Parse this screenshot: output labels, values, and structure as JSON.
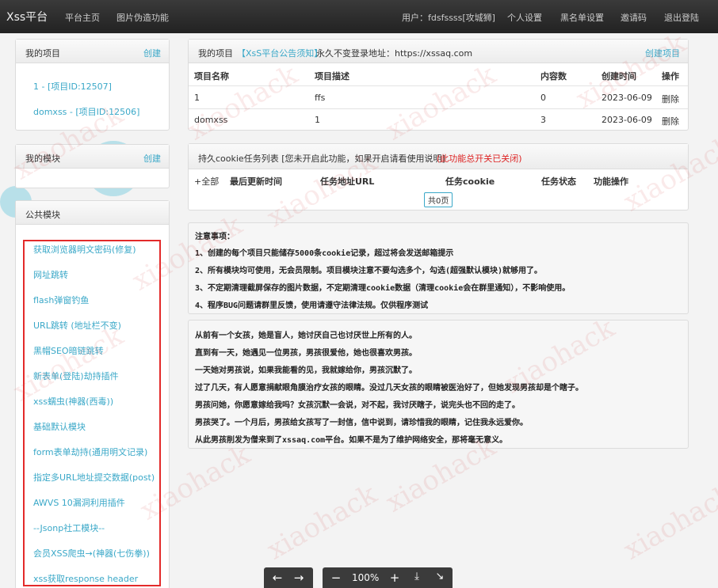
{
  "topbar": {
    "brand": "Xss平台",
    "nav_left": [
      "平台主页",
      "图片伪造功能"
    ],
    "user": "用户：fdsfssss[攻城狮]",
    "nav_right": [
      "个人设置",
      "黑名单设置",
      "邀请码",
      "退出登陆"
    ]
  },
  "sidebar": {
    "projects": {
      "title": "我的项目",
      "create": "创建",
      "items": [
        "1 - [项目ID:12507]",
        "domxss - [项目ID:12506]"
      ]
    },
    "modules": {
      "title": "我的模块",
      "create": "创建"
    },
    "public": {
      "title": "公共模块",
      "items": [
        "获取浏览器明文密码(修复)",
        "网址跳转",
        "flash弹窗钓鱼",
        "URL跳转 (地址栏不变)",
        "黑帽SEO暗链跳转",
        "新表单(登陆)劫持插件",
        "xss蠕虫(神器(西毒))",
        "基础默认模块",
        "form表单劫持(通用明文记录)",
        "指定多URL地址提交数据(post)",
        "AWVS 10漏洞利用插件",
        "--Jsonp社工模块--",
        "会员XSS爬虫→(神器(七伤拳))",
        "xss获取response header"
      ]
    }
  },
  "projects_panel": {
    "title": "我的项目",
    "notice": "【XsS平台公告须知】",
    "login_url_label": "永久不变登录地址：https://xssaq.com",
    "create": "创建项目",
    "headers": [
      "项目名称",
      "项目描述",
      "内容数",
      "创建时间",
      "操作"
    ],
    "rows": [
      {
        "name": "1",
        "desc": "ffs",
        "count": "0",
        "date": "2023-06-09",
        "action": "删除"
      },
      {
        "name": "domxss",
        "desc": "1",
        "count": "3",
        "date": "2023-06-09",
        "action": "删除"
      }
    ]
  },
  "cookie_panel": {
    "title": "持久cookie任务列表 [您未开启此功能，如果开启请看使用说明]",
    "warning": "(此功能总开关已关闭)",
    "add": "+全部",
    "headers": [
      "最后更新时间",
      "任务地址URL",
      "任务cookie",
      "任务状态",
      "功能操作"
    ],
    "pager": "共0页"
  },
  "notes": {
    "title": "注意事项：",
    "lines": [
      "1、创建的每个项目只能储存5000条cookie记录，超过将会发送邮箱提示",
      "2、所有模块均可使用，无会员限制。项目模块注意不要勾选多个，勾选(超强默认模块)就够用了。",
      "3、不定期清理截屏保存的图片数据，不定期清理cookie数据（清理cookie会在群里通知），不影响使用。",
      "4、程序BUG问题请群里反馈，使用请遵守法律法规。仅供程序测试"
    ]
  },
  "story": [
    "从前有一个女孩，她是盲人，她讨厌自己也讨厌世上所有的人。",
    "直到有一天，她遇见一位男孩，男孩很爱他，她也很喜欢男孩。",
    "一天她对男孩说，如果我能看的见，我就嫁给你，男孩沉默了。",
    "过了几天，有人愿意捐献眼角膜治疗女孩的眼睛。没过几天女孩的眼睛被医治好了，但她发现男孩却是个瞎子。",
    "男孩问她，你愿意嫁给我吗？女孩沉默一会说，对不起，我讨厌瞎子，说完头也不回的走了。",
    "男孩哭了。一个月后，男孩给女孩写了一封信，信中说到，请珍惜我的眼睛，记住我永远爱你。",
    "从此男孩削发为僧来到了xssaq.com平台。如果不是为了维护网络安全，那将毫无意义。"
  ],
  "watermark": "xiaohack",
  "viewer": {
    "zoom": "100%"
  }
}
